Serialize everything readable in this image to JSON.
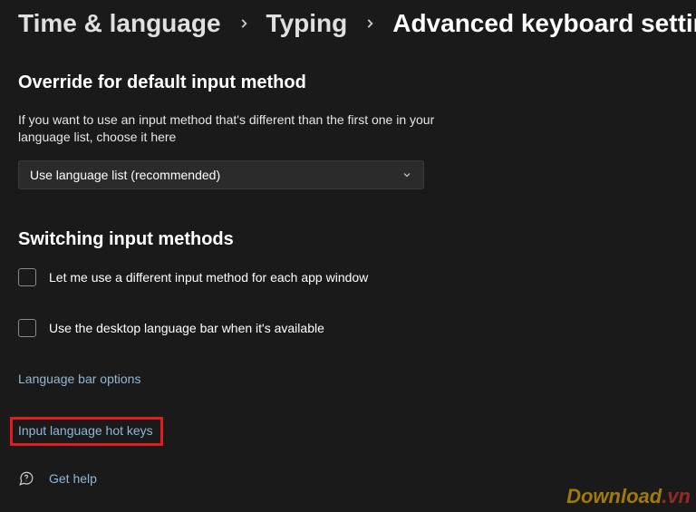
{
  "breadcrumb": {
    "level1": "Time & language",
    "level2": "Typing",
    "current": "Advanced keyboard settings"
  },
  "override": {
    "heading": "Override for default input method",
    "description": "If you want to use an input method that's different than the first one in your language list, choose it here",
    "dropdown_value": "Use language list (recommended)"
  },
  "switching": {
    "heading": "Switching input methods",
    "checkbox1_label": "Let me use a different input method for each app window",
    "checkbox2_label": "Use the desktop language bar when it's available"
  },
  "links": {
    "language_bar_options": "Language bar options",
    "input_language_hotkeys": "Input language hot keys"
  },
  "help": {
    "label": "Get help"
  },
  "watermark": {
    "part1": "Download",
    "part2": ".vn"
  }
}
